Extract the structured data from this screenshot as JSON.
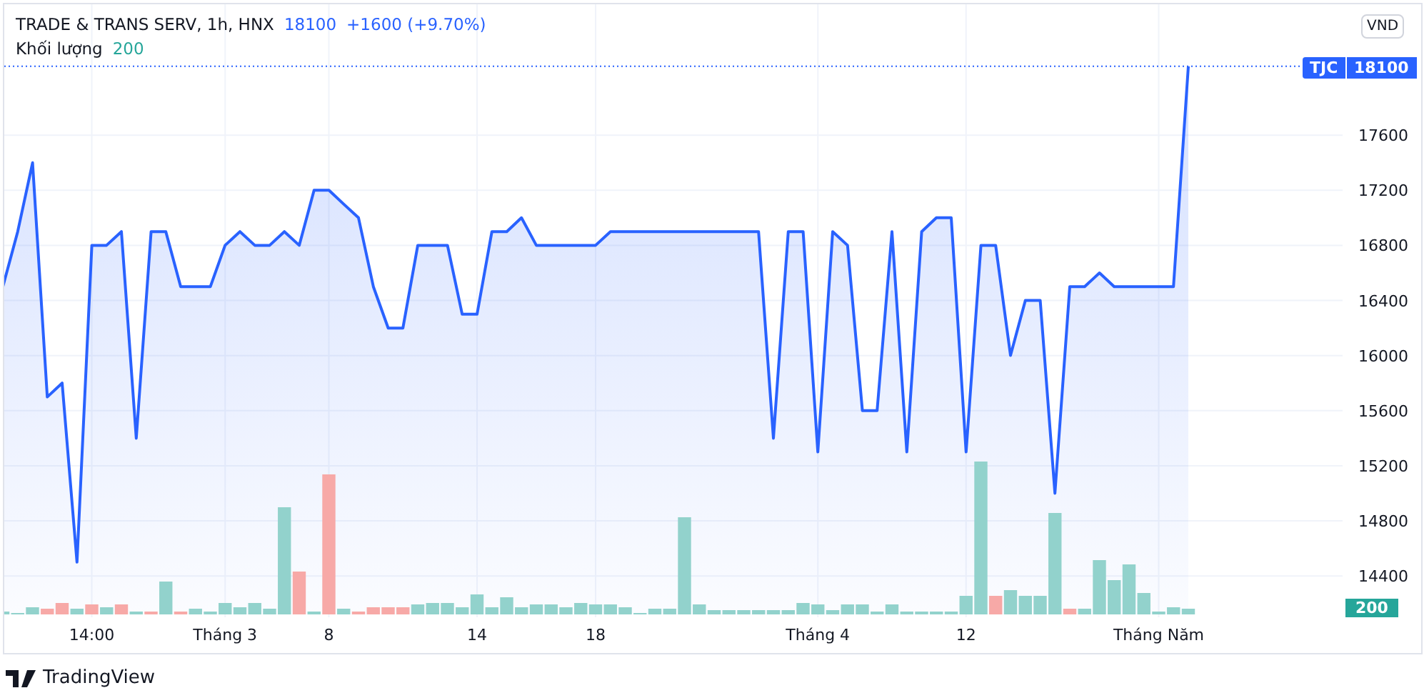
{
  "legend": {
    "symbol": "TRADE & TRANS SERV, 1h, HNX",
    "price": "18100",
    "change": "+1600 (+9.70%)",
    "volume_label": "Khối lượng",
    "volume": "200"
  },
  "currency_button": "VND",
  "price_badge": {
    "price": "18100"
  },
  "volume_badge": "200",
  "chart_data": {
    "type": "area",
    "grid": true,
    "series": [
      {
        "name": "TJC",
        "color": "#2962ff",
        "values": [
          16500,
          16900,
          17400,
          15700,
          15800,
          14500,
          16800,
          16800,
          16900,
          15400,
          16900,
          16900,
          16500,
          16500,
          16500,
          16800,
          16900,
          16800,
          16800,
          16900,
          16800,
          17200,
          17200,
          17100,
          17000,
          16500,
          16200,
          16200,
          16800,
          16800,
          16800,
          16300,
          16300,
          16900,
          16900,
          17000,
          16800,
          16800,
          16800,
          16800,
          16800,
          16900,
          16900,
          16900,
          16900,
          16900,
          16900,
          16900,
          16900,
          16900,
          16900,
          16900,
          15400,
          16900,
          16900,
          15300,
          16900,
          16800,
          15600,
          15600,
          16900,
          15300,
          16900,
          17000,
          17000,
          15300,
          16800,
          16800,
          16000,
          16400,
          16400,
          15000,
          16500,
          16500,
          16600,
          16500,
          16500,
          16500,
          16500,
          16500,
          18100
        ]
      }
    ],
    "ylim": [
      14100,
      18550
    ],
    "yticks": [
      {
        "value": 14400,
        "label": "14400"
      },
      {
        "value": 14800,
        "label": "14800"
      },
      {
        "value": 15200,
        "label": "15200"
      },
      {
        "value": 15600,
        "label": "15600"
      },
      {
        "value": 16000,
        "label": "16000"
      },
      {
        "value": 16400,
        "label": "16400"
      },
      {
        "value": 16800,
        "label": "16800"
      },
      {
        "value": 17200,
        "label": "17200"
      },
      {
        "value": 17600,
        "label": "17600"
      }
    ]
  },
  "x_axis_labels": [
    "14:00",
    "Tháng 3",
    "8",
    "14",
    "18",
    "Tháng 4",
    "12",
    "Tháng Năm"
  ],
  "brand": "TradingView"
}
